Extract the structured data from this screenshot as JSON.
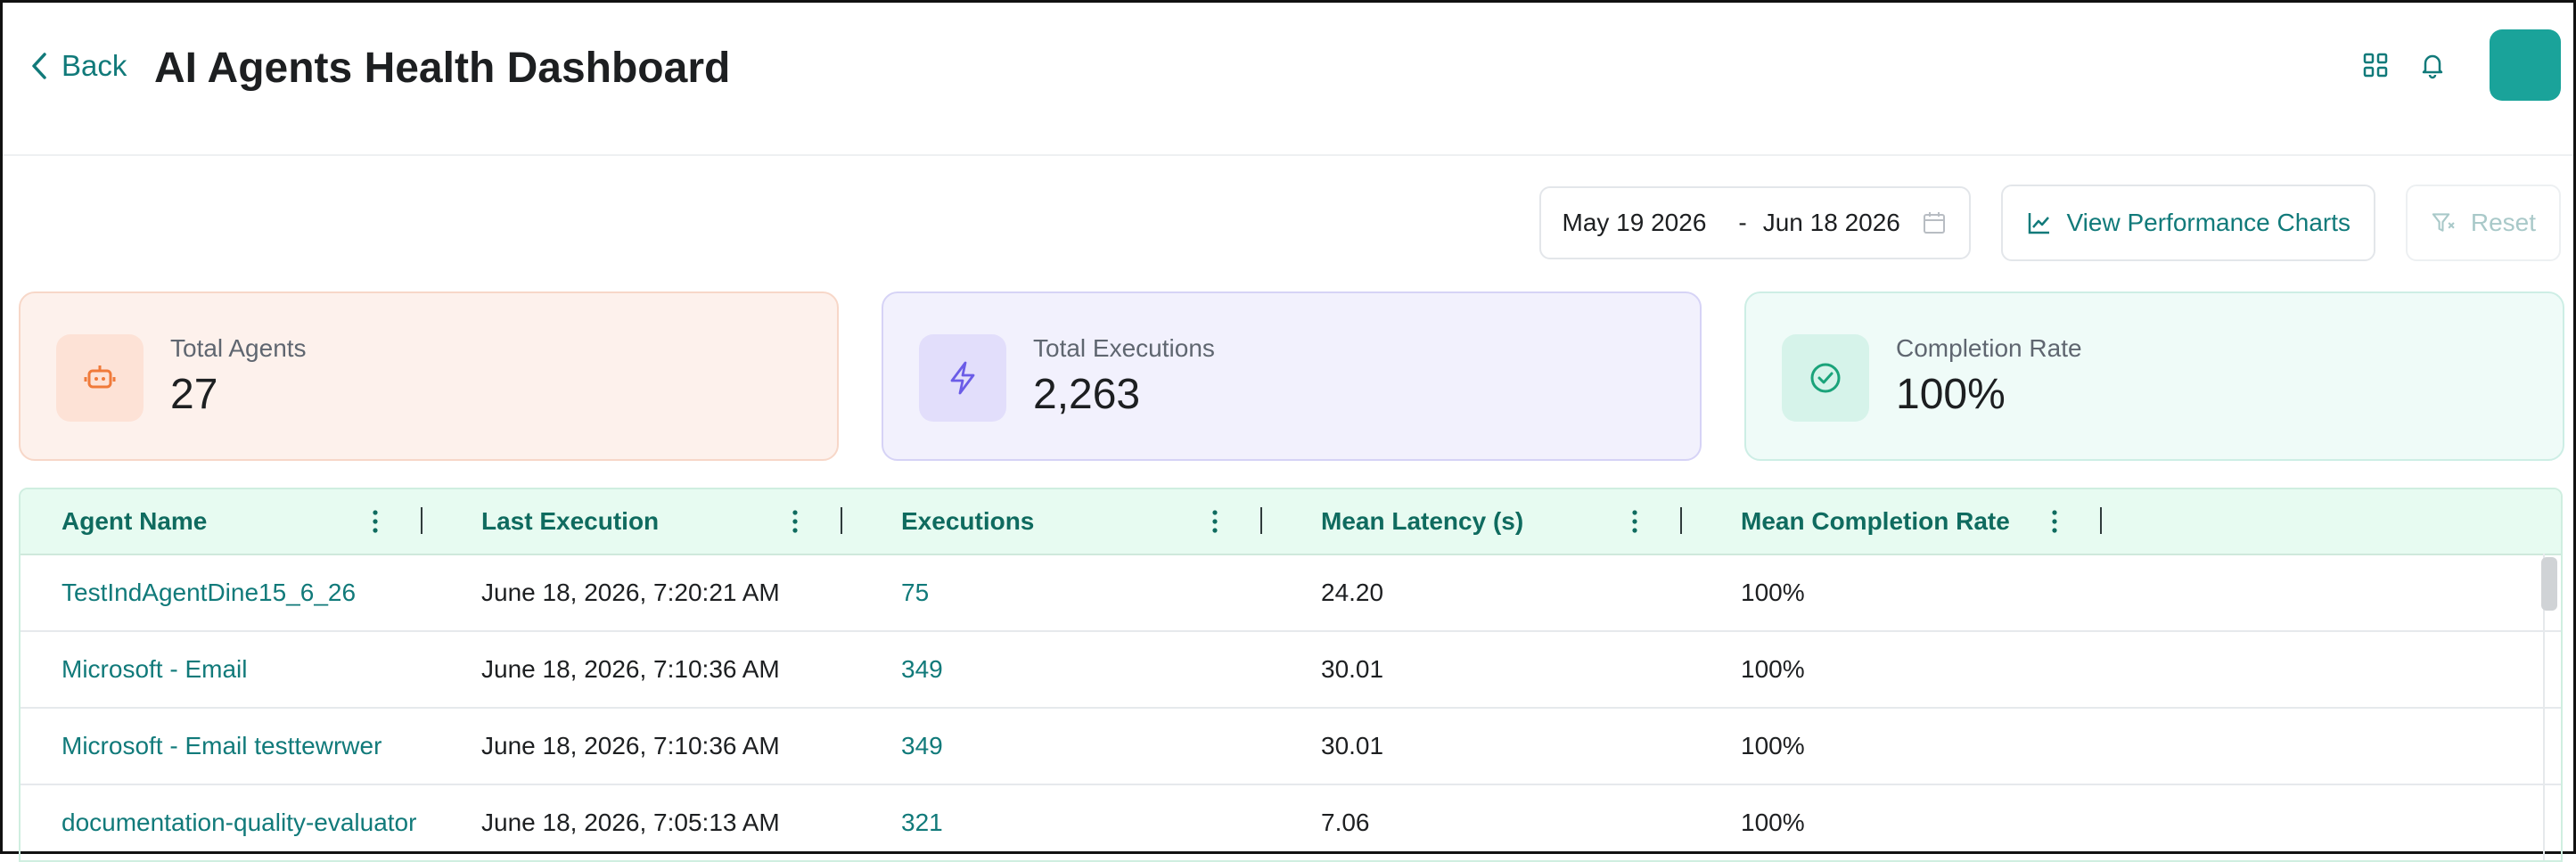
{
  "header": {
    "back_label": "Back",
    "title": "AI Agents Health Dashboard",
    "icons": [
      "grid-icon",
      "bell-icon"
    ]
  },
  "filters": {
    "start_date": "May 19 2026",
    "separator": "-",
    "end_date": "Jun 18 2026",
    "view_charts_label": "View Performance Charts",
    "reset_label": "Reset"
  },
  "stats": [
    {
      "label": "Total Agents",
      "value": "27",
      "icon": "robot-icon",
      "accent": "#f07a3a"
    },
    {
      "label": "Total Executions",
      "value": "2,263",
      "icon": "bolt-icon",
      "accent": "#6b5ce7"
    },
    {
      "label": "Completion Rate",
      "value": "100%",
      "icon": "check-circle-icon",
      "accent": "#1aa37a"
    }
  ],
  "table": {
    "columns": [
      "Agent Name",
      "Last Execution",
      "Executions",
      "Mean Latency (s)",
      "Mean Completion Rate"
    ],
    "rows": [
      [
        "TestIndAgentDine15_6_26",
        "June 18, 2026, 7:20:21 AM",
        "75",
        "24.20",
        "100%"
      ],
      [
        "Microsoft - Email",
        "June 18, 2026, 7:10:36 AM",
        "349",
        "30.01",
        "100%"
      ],
      [
        "Microsoft - Email testtewrwer",
        "June 18, 2026, 7:10:36 AM",
        "349",
        "30.01",
        "100%"
      ],
      [
        "documentation-quality-evaluator",
        "June 18, 2026, 7:05:13 AM",
        "321",
        "7.06",
        "100%"
      ]
    ]
  },
  "colors": {
    "brand": "#117a7a",
    "avatar": "#1aa39a",
    "header_bg": "#e7fbf1"
  }
}
